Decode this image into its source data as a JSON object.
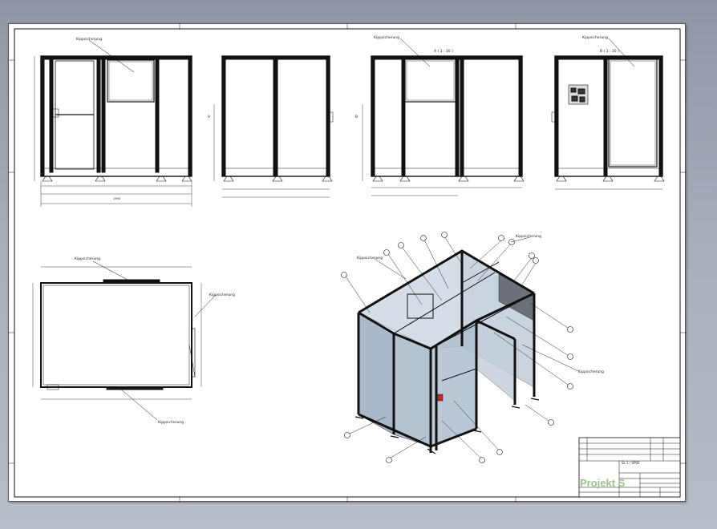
{
  "sheet": {
    "annotations": {
      "front_left": "Kippsicherung",
      "front_mid": "Kippsicherung",
      "scale_a": "A ( 1 : 10 )",
      "front_right": "Kippsicherung",
      "scale_b": "B ( 1 : 10 )",
      "plan_top": "Kippsicherung",
      "plan_right": "Kippsicherung",
      "plan_bottom": "Kippsicherung",
      "iso_top_left": "Kippsicherung",
      "iso_top_right": "Kippsicherung",
      "iso_right": "Kippsicherung",
      "view_a_marker": "A",
      "view_b_marker": "B"
    },
    "title_block": {
      "drawing_title": "SL 1 / SPSE",
      "logo_text": "Projekt S"
    }
  },
  "colors": {
    "background": "#9aa1ad",
    "sheet": "#ffffff",
    "frame": "#111111",
    "glass": "#a7b7c8",
    "logo": "#9cbf8c"
  }
}
